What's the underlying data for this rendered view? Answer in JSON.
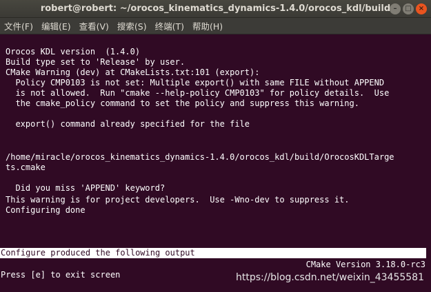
{
  "window": {
    "title": "robert@robert: ~/orocos_kinematics_dynamics-1.4.0/orocos_kdl/build",
    "buttons": {
      "min": "–",
      "max": "□",
      "close": "×"
    }
  },
  "menu": [
    {
      "label": "文件(F)"
    },
    {
      "label": "编辑(E)"
    },
    {
      "label": "查看(V)"
    },
    {
      "label": "搜索(S)"
    },
    {
      "label": "终端(T)"
    },
    {
      "label": "帮助(H)"
    }
  ],
  "terminal": {
    "lines": [
      "Orocos KDL version  (1.4.0)",
      "Build type set to 'Release' by user.",
      "CMake Warning (dev) at CMakeLists.txt:101 (export):",
      "  Policy CMP0103 is not set: Multiple export() with same FILE without APPEND",
      "  is not allowed.  Run \"cmake --help-policy CMP0103\" for policy details.  Use",
      "  the cmake_policy command to set the policy and suppress this warning.",
      "",
      "  export() command already specified for the file",
      "",
      "",
      "/home/miracle/orocos_kinematics_dynamics-1.4.0/orocos_kdl/build/OrocosKDLTarge",
      "ts.cmake",
      "",
      "  Did you miss 'APPEND' keyword?",
      "This warning is for project developers.  Use -Wno-dev to suppress it.",
      "Configuring done"
    ],
    "status_bar": "Configure produced the following output",
    "version": "CMake Version 3.18.0-rc3",
    "exit_hint": "Press [e] to exit screen"
  },
  "watermark": "https://blog.csdn.net/weixin_43455581",
  "colors": {
    "terminal_bg": "#300a24",
    "titlebar": "#3c3b37",
    "close_button": "#e9541f"
  }
}
